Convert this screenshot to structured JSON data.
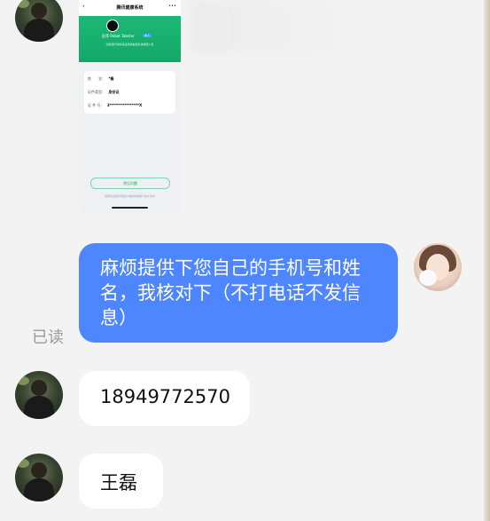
{
  "colors": {
    "outgoing_bubble": "#4e86ff",
    "incoming_bubble": "#ffffff",
    "background": "#f3f3f3",
    "read_receipt": "#9a9a9a"
  },
  "shared_screenshot": {
    "title": "腾讯健康系统",
    "user_name": "彭萍 Robot Tabster",
    "user_tag": "本人",
    "subtitle": "如有疑问请联系医院或健康系统客服人员",
    "fields": [
      {
        "label": "姓　　名:",
        "value": "*磊"
      },
      {
        "label": "证件类型:",
        "value": "身份证"
      },
      {
        "label": "证 件 号:",
        "value": "3****************X"
      }
    ],
    "button_label": "常见问题",
    "footer_text": "健康码由国务院客户端提供数据与技术支持"
  },
  "messages": [
    {
      "direction": "outgoing",
      "text": "麻烦提供下您自己的手机号和姓名，我核对下（不打电话不发信息）",
      "status": "已读"
    },
    {
      "direction": "incoming",
      "text": "18949772570"
    },
    {
      "direction": "incoming",
      "text": "王磊"
    }
  ]
}
